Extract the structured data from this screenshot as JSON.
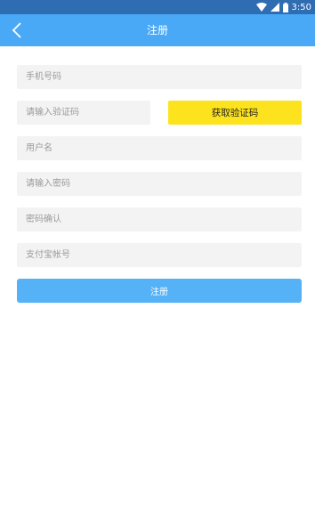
{
  "status_bar": {
    "time": "3:50",
    "icons": [
      "wifi-icon",
      "signal-icon",
      "battery-icon"
    ]
  },
  "header": {
    "title": "注册",
    "back_icon": "chevron-left-icon"
  },
  "form": {
    "phone_placeholder": "手机号码",
    "code_placeholder": "请输入验证码",
    "get_code_label": "获取验证码",
    "username_placeholder": "用户名",
    "password_placeholder": "请输入密码",
    "confirm_placeholder": "密码确认",
    "alipay_placeholder": "支付宝帐号",
    "submit_label": "注册"
  },
  "colors": {
    "status_bar": "#2f6db3",
    "header": "#4aa9f7",
    "field_bg": "#f3f3f3",
    "code_button": "#fde31e",
    "submit_button": "#56b2f7"
  }
}
